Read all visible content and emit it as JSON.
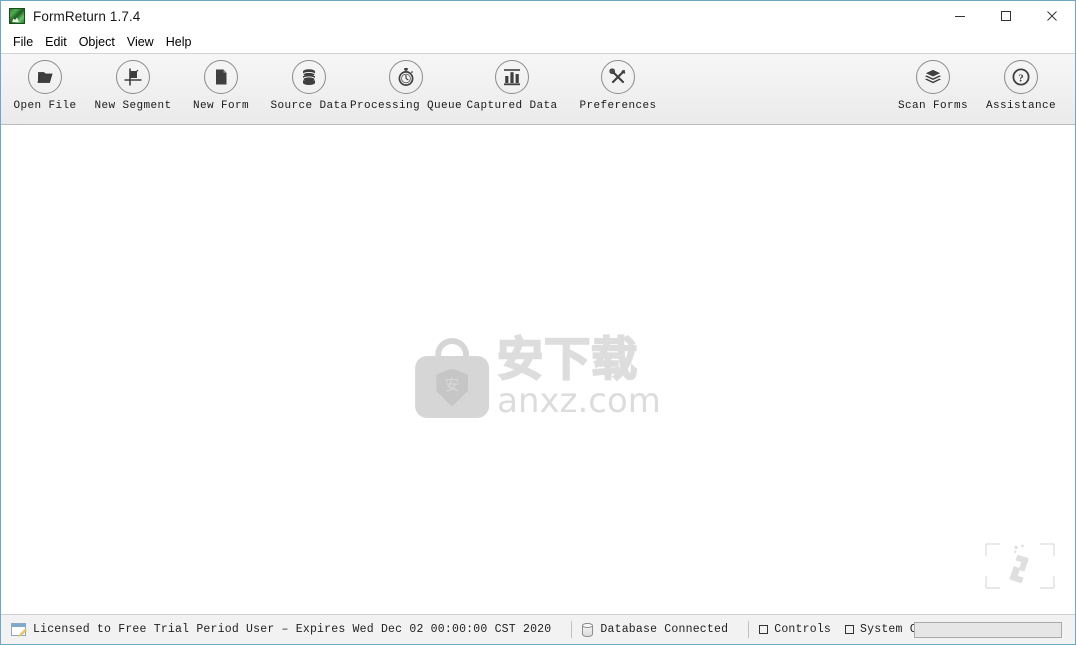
{
  "window": {
    "title": "FormReturn 1.7.4",
    "app_icon": "formreturn-app-icon",
    "minimize_label": "─",
    "maximize_label": "□",
    "close_label": "✕"
  },
  "menubar": {
    "items": [
      {
        "label": "File"
      },
      {
        "label": "Edit"
      },
      {
        "label": "Object"
      },
      {
        "label": "View"
      },
      {
        "label": "Help"
      }
    ]
  },
  "toolbar": {
    "left_buttons": [
      {
        "label": "Open File",
        "icon": "open-folder-icon"
      },
      {
        "label": "New Segment",
        "icon": "segment-marker-icon"
      },
      {
        "label": "New Form",
        "icon": "document-page-icon"
      },
      {
        "label": "Source Data",
        "icon": "database-stack-icon"
      },
      {
        "label": "Processing Queue",
        "icon": "stopwatch-icon"
      },
      {
        "label": "Captured Data",
        "icon": "bar-chart-icon"
      },
      {
        "label": "Preferences",
        "icon": "tools-cross-icon"
      }
    ],
    "right_buttons": [
      {
        "label": "Scan Forms",
        "icon": "layers-scan-icon"
      },
      {
        "label": "Assistance",
        "icon": "question-mark-icon"
      }
    ]
  },
  "content": {
    "watermark": {
      "logo_icon": "anxz-bag-shield-logo",
      "shield_char": "安",
      "chinese_text": "安下载",
      "url_text": "anxz.com"
    },
    "corner_widget_icon": "scan-frame-placeholder-icon"
  },
  "statusbar": {
    "license_icon": "license-certificate-icon",
    "license_text": "Licensed to Free Trial Period User – Expires Wed Dec 02 00:00:00 CST 2020",
    "database_icon": "database-cylinder-icon",
    "database_text": "Database Connected",
    "toggles": [
      {
        "label": "Controls",
        "icon": "checkbox-square-icon"
      },
      {
        "label": "System Console",
        "icon": "checkbox-square-icon"
      }
    ],
    "progress_value": ""
  },
  "colors": {
    "window_border": "#6ea8c4",
    "toolbar_bg": "#f0f0f0",
    "statusbar_bg": "#f2f2f2",
    "watermark_gray": "#d6d6d6",
    "text": "#1a1a1a"
  }
}
